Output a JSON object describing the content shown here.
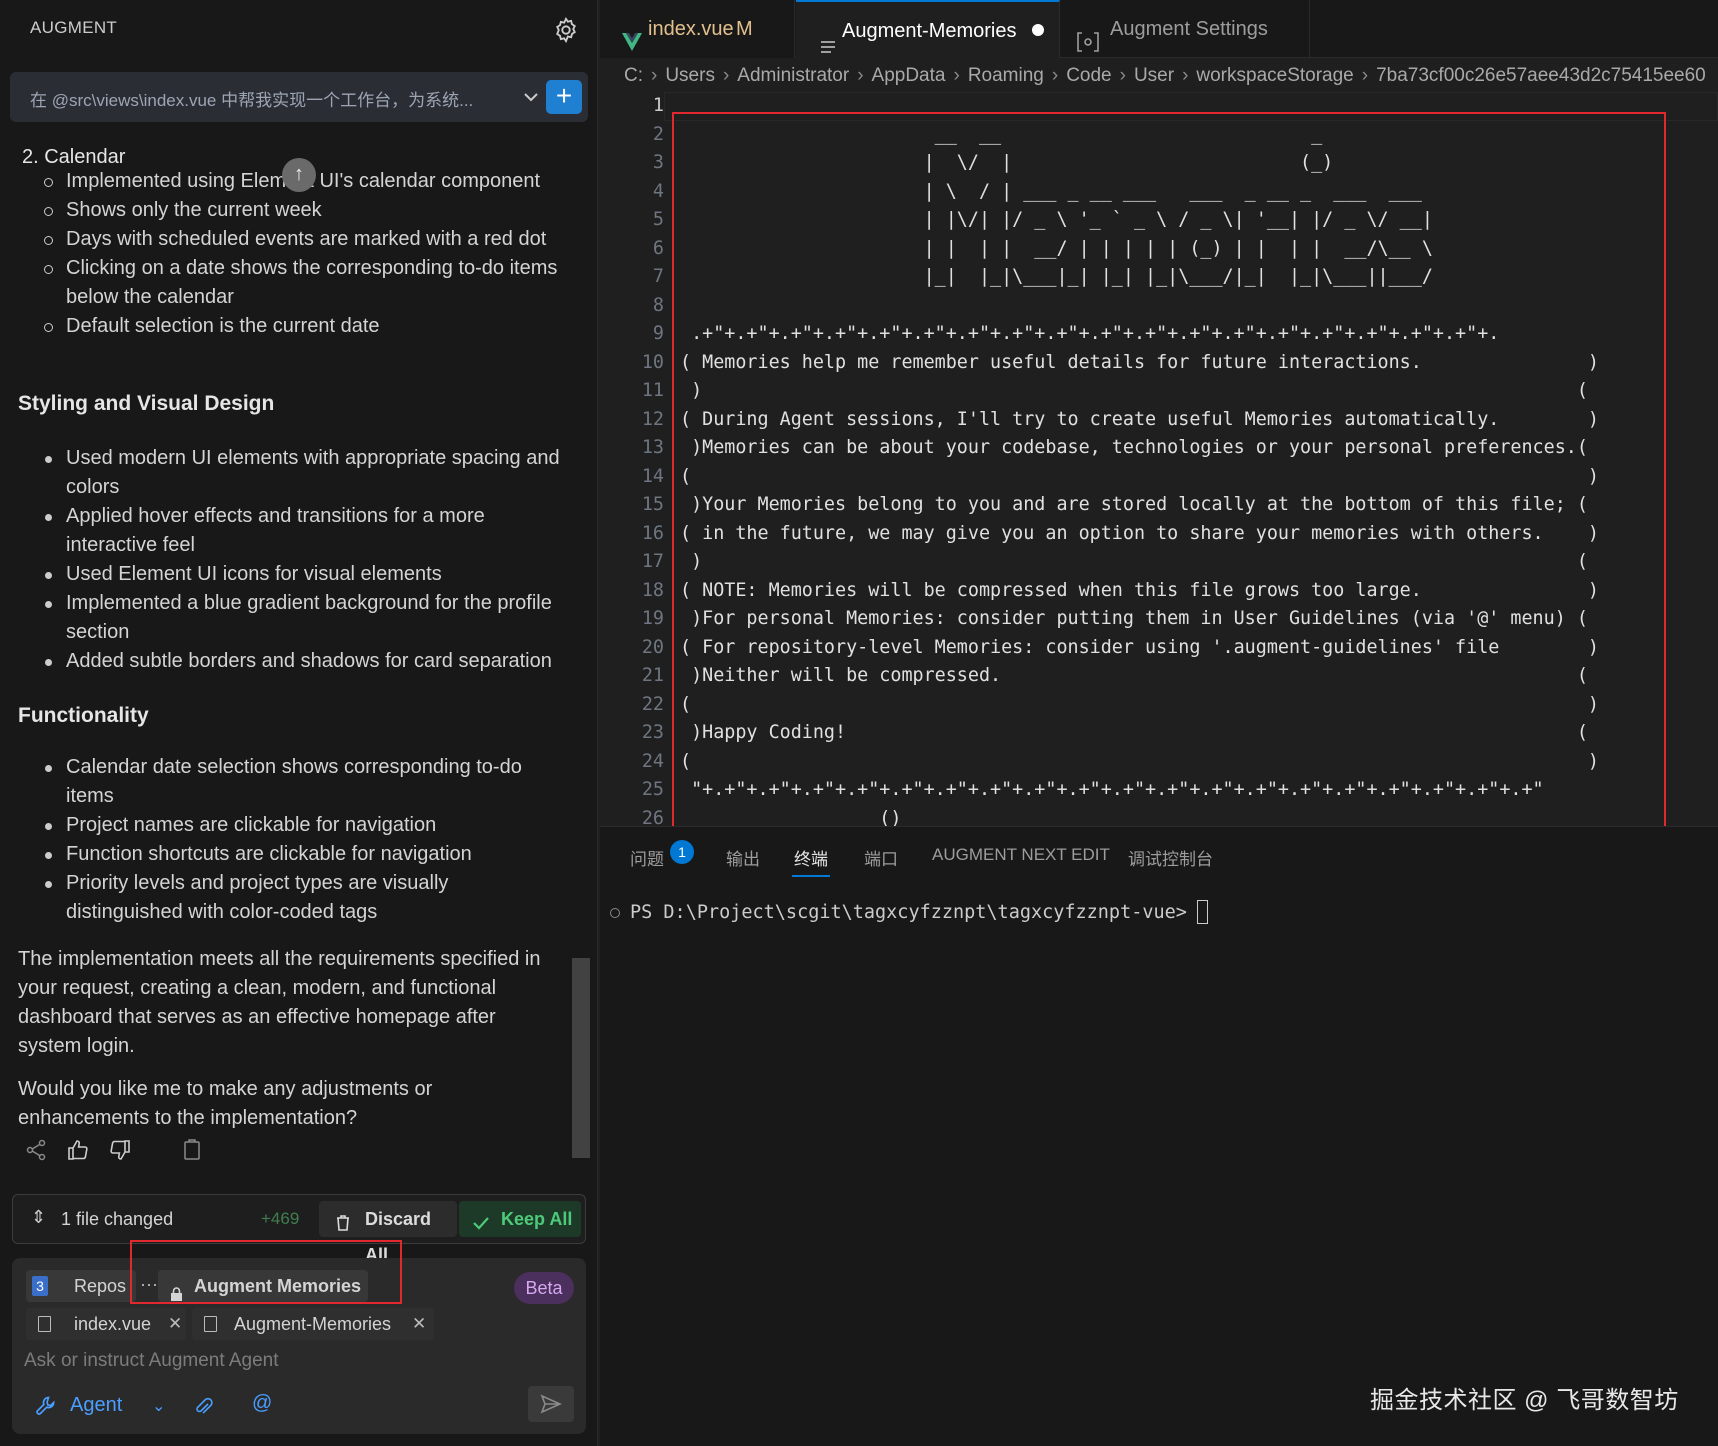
{
  "sidebar": {
    "title": "AUGMENT",
    "prompt_text": "在 @src\\views\\index.vue 中帮我实现一个工作台，为系统...",
    "chat": {
      "calendar_heading": "2. Calendar",
      "calendar_items": [
        "Implemented using Element UI's calendar component",
        "Shows only the current week",
        "Days with scheduled events are marked with a red dot",
        "Clicking on a date shows the corresponding to-do items below the calendar",
        "Default selection is the current date"
      ],
      "styling_heading": "Styling and Visual Design",
      "styling_items": [
        "Used modern UI elements with appropriate spacing and colors",
        "Applied hover effects and transitions for a more interactive feel",
        "Used Element UI icons for visual elements",
        "Implemented a blue gradient background for the profile section",
        "Added subtle borders and shadows for card separation"
      ],
      "functionality_heading": "Functionality",
      "functionality_items": [
        "Calendar date selection shows corresponding to-do items",
        "Project names are clickable for navigation",
        "Function shortcuts are clickable for navigation",
        "Priority levels and project types are visually distinguished with color-coded tags"
      ],
      "summary": "The implementation meets all the requirements specified in your request, creating a clean, modern, and functional dashboard that serves as an effective homepage after system login.",
      "question": "Would you like me to make any adjustments or enhancements to the implementation?"
    },
    "file_bar": {
      "changed": "1 file changed",
      "plus_count": "+469",
      "discard": "Discard All",
      "keep": "Keep All"
    },
    "input": {
      "repos_count": "3",
      "repos_label": "Repos",
      "more": "···",
      "memories_chip": "Augment Memories",
      "beta": "Beta",
      "context_files": [
        "index.vue",
        "Augment-Memories"
      ],
      "close": "✕",
      "placeholder": "Ask or instruct Augment Agent",
      "mode": "Agent",
      "at": "@"
    }
  },
  "editor": {
    "tabs": [
      {
        "label": "index.vue",
        "status": "M"
      },
      {
        "label": "Augment-Memories"
      },
      {
        "label": "Augment Settings"
      }
    ],
    "breadcrumb": [
      "C:",
      "Users",
      "Administrator",
      "AppData",
      "Roaming",
      "Code",
      "User",
      "workspaceStorage",
      "7ba73cf00c26e57aee43d2c75415ee60"
    ],
    "lines": [
      "",
      "                       __  __                            _",
      "                      |  \\/  |                          (_)",
      "                      | \\  / | ___ _ __ ___   ___  _ __ _  ___  ___",
      "                      | |\\/| |/ _ \\ '_ ` _ \\ / _ \\| '__| |/ _ \\/ __|",
      "                      | |  | |  __/ | | | | | (_) | |  | |  __/\\__ \\",
      "                      |_|  |_|\\___|_| |_| |_|\\___/|_|  |_|\\___||___/",
      "",
      " .+\"+.+\"+.+\"+.+\"+.+\"+.+\"+.+\"+.+\"+.+\"+.+\"+.+\"+.+\"+.+\"+.+\"+.+\"+.+\"+.+\"+.+\"+.",
      "( Memories help me remember useful details for future interactions.               )",
      " )                                                                               (",
      "( During Agent sessions, I'll try to create useful Memories automatically.        )",
      " )Memories can be about your codebase, technologies or your personal preferences.(",
      "(                                                                                 )",
      " )Your Memories belong to you and are stored locally at the bottom of this file; (",
      "( in the future, we may give you an option to share your memories with others.    )",
      " )                                                                               (",
      "( NOTE: Memories will be compressed when this file grows too large.               )",
      " )For personal Memories: consider putting them in User Guidelines (via '@' menu) (",
      "( For repository-level Memories: consider using '.augment-guidelines' file        )",
      " )Neither will be compressed.                                                    (",
      "(                                                                                 )",
      " )Happy Coding!                                                                  (",
      "(                                                                                 )",
      " \"+.+\"+.+\"+.+\"+.+\"+.+\"+.+\"+.+\"+.+\"+.+\"+.+\"+.+\"+.+\"+.+\"+.+\"+.+\"+.+\"+.+\"+.+\"+.+\"",
      "                  ()"
    ],
    "active_line": "1"
  },
  "panel": {
    "tabs": [
      "问题",
      "输出",
      "终端",
      "端口",
      "AUGMENT NEXT EDIT",
      "调试控制台"
    ],
    "problems_count": "1",
    "terminal_prompt": "PS D:\\Project\\scgit\\tagxcyfzznpt\\tagxcyfzznpt-vue>"
  },
  "watermark": "掘金技术社区 @ 飞哥数智坊"
}
